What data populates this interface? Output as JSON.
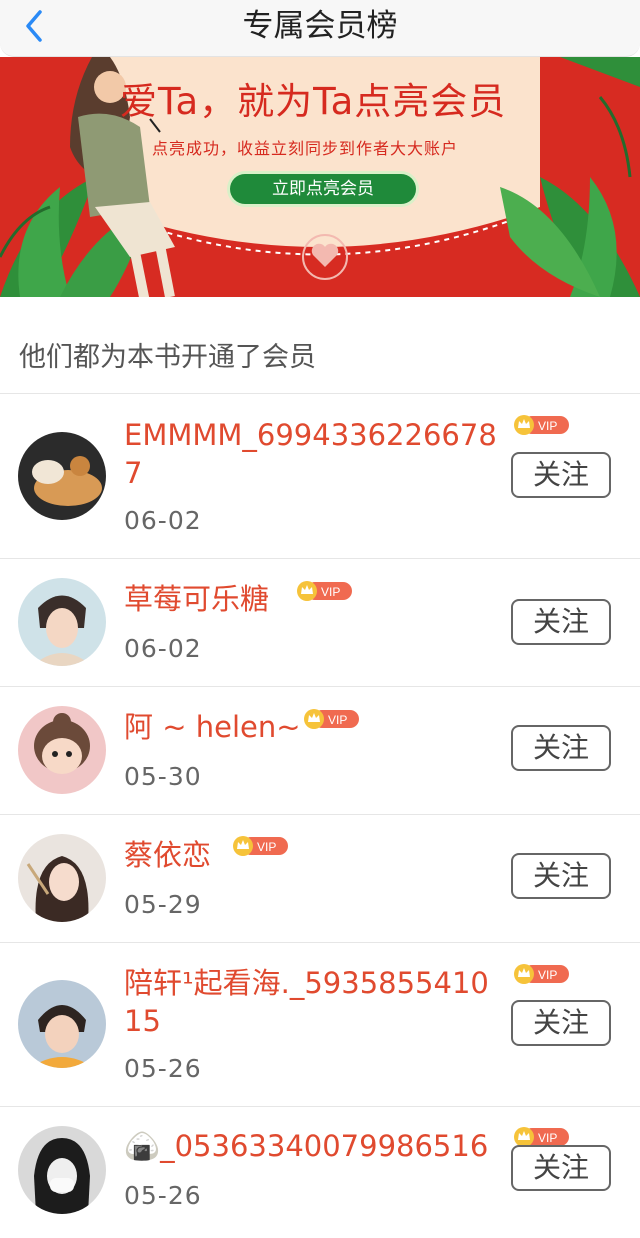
{
  "header": {
    "title": "专属会员榜"
  },
  "banner": {
    "headline": "爱Ta，就为Ta点亮会员",
    "subtitle": "点亮成功，收益立刻同步到作者大大账户",
    "button": "立即点亮会员"
  },
  "section": {
    "text": "他们都为本书开通了会员"
  },
  "vip_label": "VIP",
  "members": [
    {
      "name": "EMMMM_69943362266787",
      "date": "06-02",
      "follow": "关注"
    },
    {
      "name": "草莓可乐糖",
      "date": "06-02",
      "follow": "关注"
    },
    {
      "name": "阿 ~ helen~",
      "date": "05-30",
      "follow": "关注"
    },
    {
      "name": "蔡依恋",
      "date": "05-29",
      "follow": "关注"
    },
    {
      "name": "陪轩¹起看海._593585541015",
      "date": "05-26",
      "follow": "关注"
    },
    {
      "name": "🍙_05363340079986516",
      "date": "05-26",
      "follow": "关注"
    }
  ],
  "colors": {
    "accent": "#e04a2f",
    "banner_red": "#d72b22",
    "button_green": "#1f8a3a"
  }
}
